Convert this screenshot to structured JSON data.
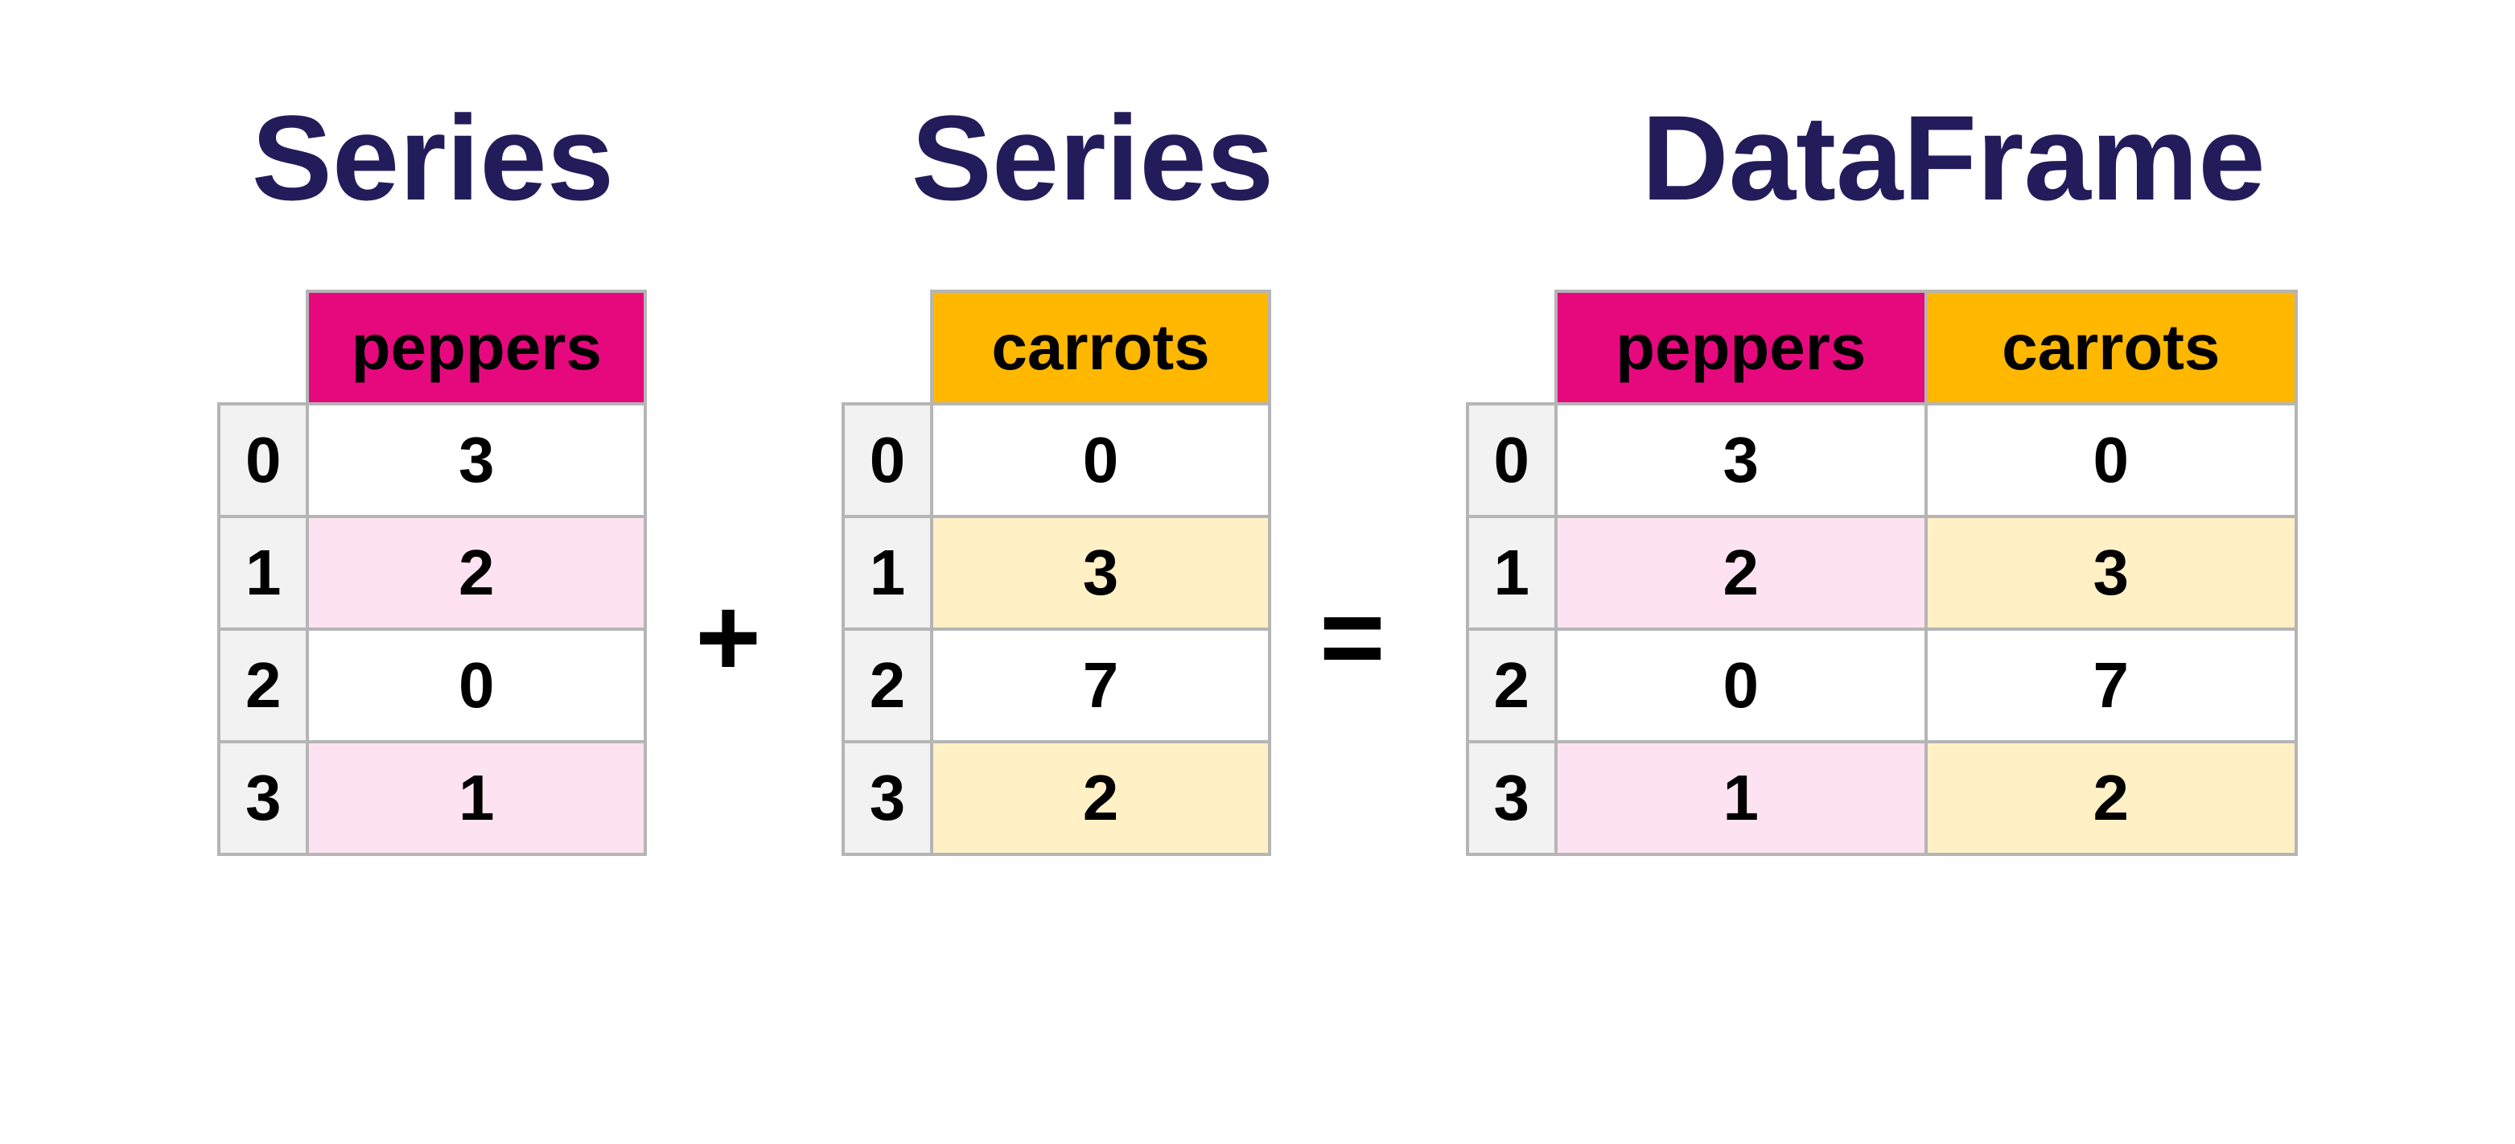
{
  "titles": {
    "series1": "Series",
    "series2": "Series",
    "dataframe": "DataFrame"
  },
  "operators": {
    "plus": "+",
    "equals": "="
  },
  "colors": {
    "title": "#231c5b",
    "peppers_header": "#e6097e",
    "carrots_header": "#ffb700",
    "peppers_stripe": "#fde3f1",
    "carrots_stripe": "#fff0c6",
    "index_bg": "#f2f2f2",
    "border": "#b5b5b5"
  },
  "series1": {
    "name": "peppers",
    "index": [
      "0",
      "1",
      "2",
      "3"
    ],
    "values": [
      "3",
      "2",
      "0",
      "1"
    ]
  },
  "series2": {
    "name": "carrots",
    "index": [
      "0",
      "1",
      "2",
      "3"
    ],
    "values": [
      "0",
      "3",
      "7",
      "2"
    ]
  },
  "dataframe": {
    "columns": [
      "peppers",
      "carrots"
    ],
    "index": [
      "0",
      "1",
      "2",
      "3"
    ],
    "rows": [
      {
        "peppers": "3",
        "carrots": "0"
      },
      {
        "peppers": "2",
        "carrots": "3"
      },
      {
        "peppers": "0",
        "carrots": "7"
      },
      {
        "peppers": "1",
        "carrots": "2"
      }
    ]
  },
  "chart_data": {
    "type": "table",
    "title": "Series + Series = DataFrame",
    "series": [
      {
        "name": "peppers",
        "index": [
          0,
          1,
          2,
          3
        ],
        "values": [
          3,
          2,
          0,
          1
        ]
      },
      {
        "name": "carrots",
        "index": [
          0,
          1,
          2,
          3
        ],
        "values": [
          0,
          3,
          7,
          2
        ]
      }
    ],
    "dataframe": {
      "columns": [
        "peppers",
        "carrots"
      ],
      "index": [
        0,
        1,
        2,
        3
      ],
      "data": [
        [
          3,
          0
        ],
        [
          2,
          3
        ],
        [
          0,
          7
        ],
        [
          1,
          2
        ]
      ]
    }
  }
}
